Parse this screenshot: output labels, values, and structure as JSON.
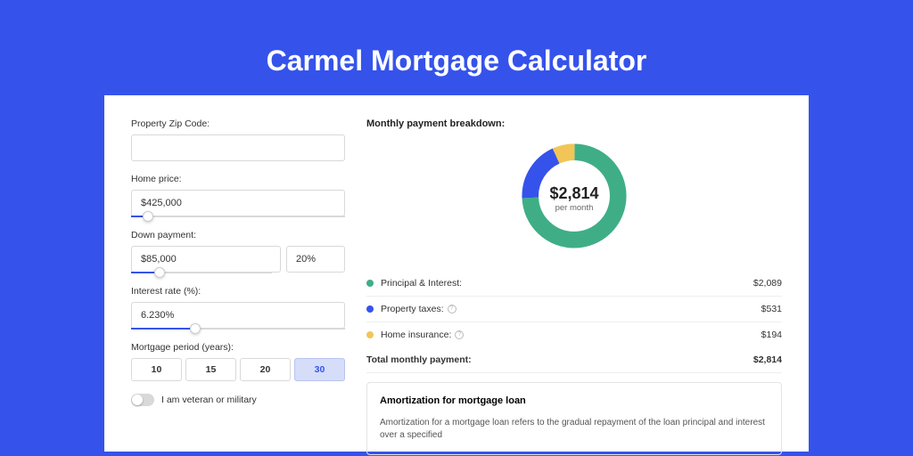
{
  "title": "Carmel Mortgage Calculator",
  "form": {
    "zip_label": "Property Zip Code:",
    "zip_value": "",
    "home_price_label": "Home price:",
    "home_price_value": "$425,000",
    "home_price_slider_pct": 8,
    "down_payment_label": "Down payment:",
    "down_payment_value": "$85,000",
    "down_payment_pct_value": "20%",
    "down_payment_slider_pct": 20,
    "interest_label": "Interest rate (%):",
    "interest_value": "6.230%",
    "interest_slider_pct": 30,
    "period_label": "Mortgage period (years):",
    "periods": [
      "10",
      "15",
      "20",
      "30"
    ],
    "period_active_index": 3,
    "veteran_label": "I am veteran or military"
  },
  "breakdown": {
    "title": "Monthly payment breakdown:",
    "donut_amount": "$2,814",
    "donut_sub": "per month",
    "items": [
      {
        "label": "Principal & Interest:",
        "value": "$2,089",
        "color": "#3fae87",
        "info": false
      },
      {
        "label": "Property taxes:",
        "value": "$531",
        "color": "#3553eb",
        "info": true
      },
      {
        "label": "Home insurance:",
        "value": "$194",
        "color": "#f1c557",
        "info": true
      }
    ],
    "total_label": "Total monthly payment:",
    "total_value": "$2,814"
  },
  "amortization": {
    "title": "Amortization for mortgage loan",
    "text": "Amortization for a mortgage loan refers to the gradual repayment of the loan principal and interest over a specified"
  },
  "chart_data": {
    "type": "pie",
    "title": "Monthly payment breakdown",
    "series": [
      {
        "name": "Principal & Interest",
        "value": 2089,
        "color": "#3fae87"
      },
      {
        "name": "Property taxes",
        "value": 531,
        "color": "#3553eb"
      },
      {
        "name": "Home insurance",
        "value": 194,
        "color": "#f1c557"
      }
    ],
    "total": 2814,
    "center_label": "$2,814 per month"
  }
}
